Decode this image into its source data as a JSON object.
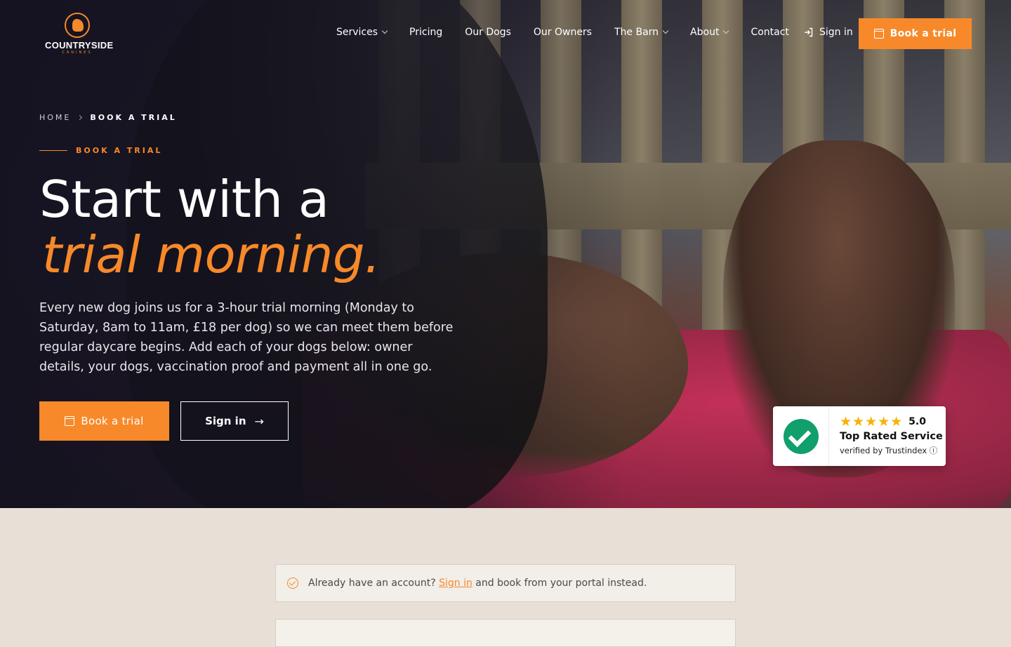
{
  "nav": {
    "logo_text": "COUNTRYSIDE",
    "logo_sub": "CANINES",
    "items": [
      {
        "label": "Services",
        "dropdown": true
      },
      {
        "label": "Pricing",
        "dropdown": false
      },
      {
        "label": "Our Dogs",
        "dropdown": false
      },
      {
        "label": "Our Owners",
        "dropdown": false
      },
      {
        "label": "The Barn",
        "dropdown": true
      },
      {
        "label": "About",
        "dropdown": true
      },
      {
        "label": "Contact",
        "dropdown": false
      }
    ],
    "signin_label": "Sign in",
    "cta_label": "Book a trial"
  },
  "breadcrumb": {
    "home": "HOME",
    "current": "BOOK A TRIAL"
  },
  "hero": {
    "eyebrow": "BOOK A TRIAL",
    "title_line1": "Start with a",
    "title_line2": "trial morning.",
    "lede": "Every new dog joins us for a 3-hour trial morning (Monday to Saturday, 8am to 11am, £18 per dog) so we can meet them before regular daycare begins. Add each of your dogs below: owner details, your dogs, vaccination proof and payment all in one go.",
    "primary_button": "Book a trial",
    "secondary_button": "Sign in",
    "secondary_arrow": "→"
  },
  "trust_badge": {
    "stars": "★★★★★",
    "score": "5.0",
    "title": "Top Rated Service",
    "subtitle": "verified by Trustindex ⓘ"
  },
  "notice": {
    "prefix": "Already have an account?",
    "link": "Sign in",
    "suffix": "and book from your portal instead."
  },
  "colors": {
    "accent": "#f7892a",
    "hero_overlay": "#16142a",
    "page_bg": "#e8e0d6",
    "trust_green": "#119f6b"
  }
}
